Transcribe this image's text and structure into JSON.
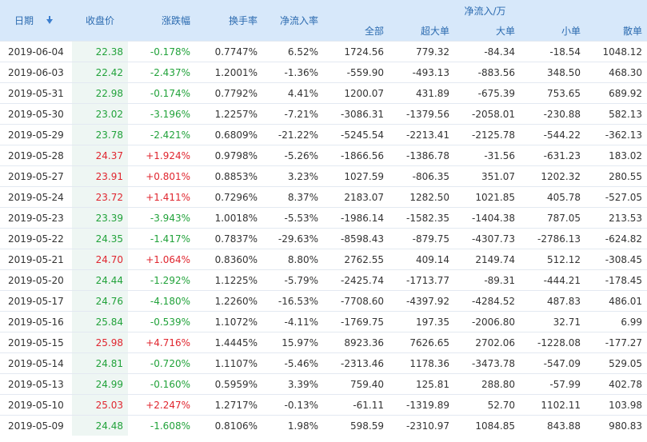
{
  "headers": {
    "date": "日期",
    "close": "收盘价",
    "change": "涨跌幅",
    "turnover": "换手率",
    "net_rate": "净流入率",
    "net_group": "净流入/万",
    "all": "全部",
    "super_large": "超大单",
    "large": "大单",
    "small": "小单",
    "retail": "散单"
  },
  "rows": [
    {
      "date": "2019-06-04",
      "close": "22.38",
      "change": "-0.178%",
      "turnover": "0.7747%",
      "net_rate": "6.52%",
      "all": "1724.56",
      "super_large": "779.32",
      "large": "-84.34",
      "small": "-18.54",
      "retail": "1048.12",
      "trend": "down"
    },
    {
      "date": "2019-06-03",
      "close": "22.42",
      "change": "-2.437%",
      "turnover": "1.2001%",
      "net_rate": "-1.36%",
      "all": "-559.90",
      "super_large": "-493.13",
      "large": "-883.56",
      "small": "348.50",
      "retail": "468.30",
      "trend": "down"
    },
    {
      "date": "2019-05-31",
      "close": "22.98",
      "change": "-0.174%",
      "turnover": "0.7792%",
      "net_rate": "4.41%",
      "all": "1200.07",
      "super_large": "431.89",
      "large": "-675.39",
      "small": "753.65",
      "retail": "689.92",
      "trend": "down"
    },
    {
      "date": "2019-05-30",
      "close": "23.02",
      "change": "-3.196%",
      "turnover": "1.2257%",
      "net_rate": "-7.21%",
      "all": "-3086.31",
      "super_large": "-1379.56",
      "large": "-2058.01",
      "small": "-230.88",
      "retail": "582.13",
      "trend": "down"
    },
    {
      "date": "2019-05-29",
      "close": "23.78",
      "change": "-2.421%",
      "turnover": "0.6809%",
      "net_rate": "-21.22%",
      "all": "-5245.54",
      "super_large": "-2213.41",
      "large": "-2125.78",
      "small": "-544.22",
      "retail": "-362.13",
      "trend": "down"
    },
    {
      "date": "2019-05-28",
      "close": "24.37",
      "change": "+1.924%",
      "turnover": "0.9798%",
      "net_rate": "-5.26%",
      "all": "-1866.56",
      "super_large": "-1386.78",
      "large": "-31.56",
      "small": "-631.23",
      "retail": "183.02",
      "trend": "up"
    },
    {
      "date": "2019-05-27",
      "close": "23.91",
      "change": "+0.801%",
      "turnover": "0.8853%",
      "net_rate": "3.23%",
      "all": "1027.59",
      "super_large": "-806.35",
      "large": "351.07",
      "small": "1202.32",
      "retail": "280.55",
      "trend": "up"
    },
    {
      "date": "2019-05-24",
      "close": "23.72",
      "change": "+1.411%",
      "turnover": "0.7296%",
      "net_rate": "8.37%",
      "all": "2183.07",
      "super_large": "1282.50",
      "large": "1021.85",
      "small": "405.78",
      "retail": "-527.05",
      "trend": "up"
    },
    {
      "date": "2019-05-23",
      "close": "23.39",
      "change": "-3.943%",
      "turnover": "1.0018%",
      "net_rate": "-5.53%",
      "all": "-1986.14",
      "super_large": "-1582.35",
      "large": "-1404.38",
      "small": "787.05",
      "retail": "213.53",
      "trend": "down"
    },
    {
      "date": "2019-05-22",
      "close": "24.35",
      "change": "-1.417%",
      "turnover": "0.7837%",
      "net_rate": "-29.63%",
      "all": "-8598.43",
      "super_large": "-879.75",
      "large": "-4307.73",
      "small": "-2786.13",
      "retail": "-624.82",
      "trend": "down"
    },
    {
      "date": "2019-05-21",
      "close": "24.70",
      "change": "+1.064%",
      "turnover": "0.8360%",
      "net_rate": "8.80%",
      "all": "2762.55",
      "super_large": "409.14",
      "large": "2149.74",
      "small": "512.12",
      "retail": "-308.45",
      "trend": "up"
    },
    {
      "date": "2019-05-20",
      "close": "24.44",
      "change": "-1.292%",
      "turnover": "1.1225%",
      "net_rate": "-5.79%",
      "all": "-2425.74",
      "super_large": "-1713.77",
      "large": "-89.31",
      "small": "-444.21",
      "retail": "-178.45",
      "trend": "down"
    },
    {
      "date": "2019-05-17",
      "close": "24.76",
      "change": "-4.180%",
      "turnover": "1.2260%",
      "net_rate": "-16.53%",
      "all": "-7708.60",
      "super_large": "-4397.92",
      "large": "-4284.52",
      "small": "487.83",
      "retail": "486.01",
      "trend": "down"
    },
    {
      "date": "2019-05-16",
      "close": "25.84",
      "change": "-0.539%",
      "turnover": "1.1072%",
      "net_rate": "-4.11%",
      "all": "-1769.75",
      "super_large": "197.35",
      "large": "-2006.80",
      "small": "32.71",
      "retail": "6.99",
      "trend": "down"
    },
    {
      "date": "2019-05-15",
      "close": "25.98",
      "change": "+4.716%",
      "turnover": "1.4445%",
      "net_rate": "15.97%",
      "all": "8923.36",
      "super_large": "7626.65",
      "large": "2702.06",
      "small": "-1228.08",
      "retail": "-177.27",
      "trend": "up"
    },
    {
      "date": "2019-05-14",
      "close": "24.81",
      "change": "-0.720%",
      "turnover": "1.1107%",
      "net_rate": "-5.46%",
      "all": "-2313.46",
      "super_large": "1178.36",
      "large": "-3473.78",
      "small": "-547.09",
      "retail": "529.05",
      "trend": "down"
    },
    {
      "date": "2019-05-13",
      "close": "24.99",
      "change": "-0.160%",
      "turnover": "0.5959%",
      "net_rate": "3.39%",
      "all": "759.40",
      "super_large": "125.81",
      "large": "288.80",
      "small": "-57.99",
      "retail": "402.78",
      "trend": "down"
    },
    {
      "date": "2019-05-10",
      "close": "25.03",
      "change": "+2.247%",
      "turnover": "1.2717%",
      "net_rate": "-0.13%",
      "all": "-61.11",
      "super_large": "-1319.89",
      "large": "52.70",
      "small": "1102.11",
      "retail": "103.98",
      "trend": "up"
    },
    {
      "date": "2019-05-09",
      "close": "24.48",
      "change": "-1.608%",
      "turnover": "0.8106%",
      "net_rate": "1.98%",
      "all": "598.59",
      "super_large": "-2310.97",
      "large": "1084.85",
      "small": "843.88",
      "retail": "980.83",
      "trend": "down"
    }
  ],
  "icons": {
    "sort": "sort-down-arrow-icon"
  },
  "colors": {
    "up": "#e0262f",
    "down": "#21a23a",
    "header_bg": "#d7e8fa",
    "header_text": "#2c6bb0",
    "price_bg": "#eef6f3"
  }
}
